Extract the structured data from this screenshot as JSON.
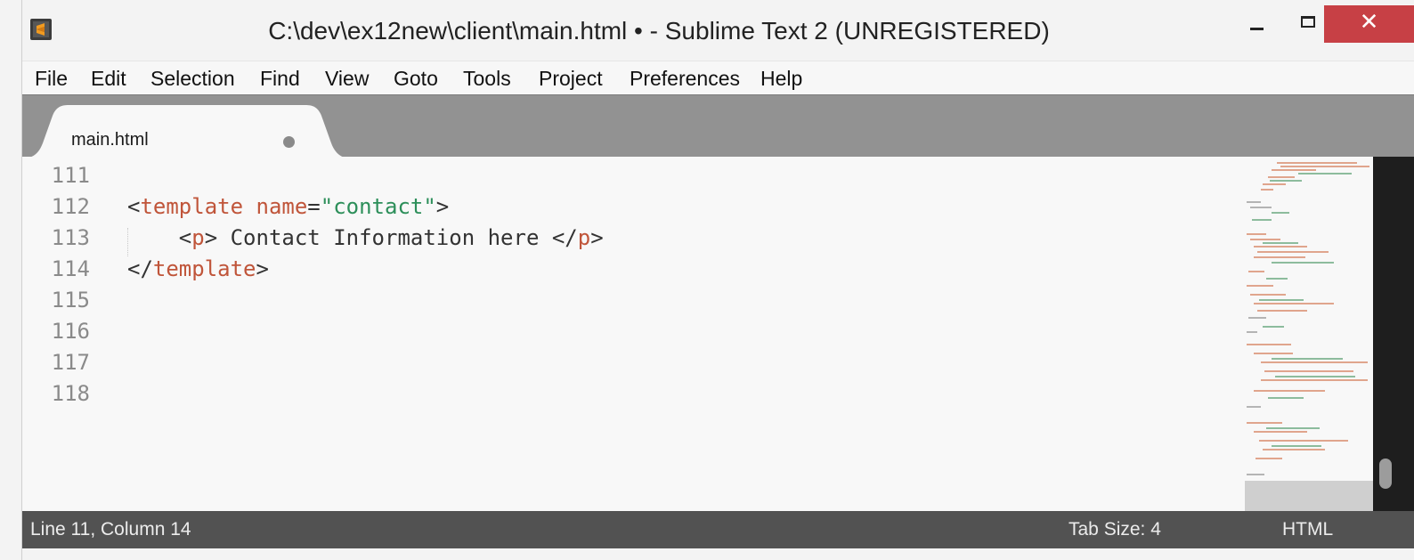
{
  "window": {
    "title": "C:\\dev\\ex12new\\client\\main.html • - Sublime Text 2 (UNREGISTERED)",
    "close_glyph": "✕"
  },
  "menu": {
    "items": [
      {
        "label": "File"
      },
      {
        "label": "Edit"
      },
      {
        "label": "Selection"
      },
      {
        "label": "Find"
      },
      {
        "label": "View"
      },
      {
        "label": "Goto"
      },
      {
        "label": "Tools"
      },
      {
        "label": "Project"
      },
      {
        "label": "Preferences"
      },
      {
        "label": "Help"
      }
    ]
  },
  "tabs": [
    {
      "label": "main.html",
      "modified": true
    }
  ],
  "editor": {
    "line_numbers": [
      "111",
      "112",
      "113",
      "114",
      "115",
      "116",
      "117",
      "118"
    ],
    "lines": {
      "l112": {
        "open": "<",
        "tag": "template",
        "sp": " ",
        "attr": "name",
        "eq": "=",
        "val": "\"contact\"",
        "close": ">"
      },
      "l113": {
        "indent": "    ",
        "open": "<",
        "tag": "p",
        "close": ">",
        "text": " Contact Information here ",
        "open2": "</",
        "tag2": "p",
        "close2": ">"
      },
      "l114": {
        "open": "</",
        "tag": "template",
        "close": ">"
      }
    }
  },
  "status": {
    "position": "Line 11, Column 14",
    "tab_size": "Tab Size: 4",
    "syntax": "HTML"
  },
  "colors": {
    "tag": "#c0553a",
    "string": "#2d8f5a",
    "text": "#333333",
    "close_button": "#c74045",
    "tab_bar": "#929292",
    "status_bar": "#525252"
  },
  "icons": {
    "app": "sublime-text-icon",
    "minimize": "minimize-icon",
    "maximize": "maximize-icon",
    "close": "close-icon",
    "tab_modified": "modified-dot-icon"
  }
}
